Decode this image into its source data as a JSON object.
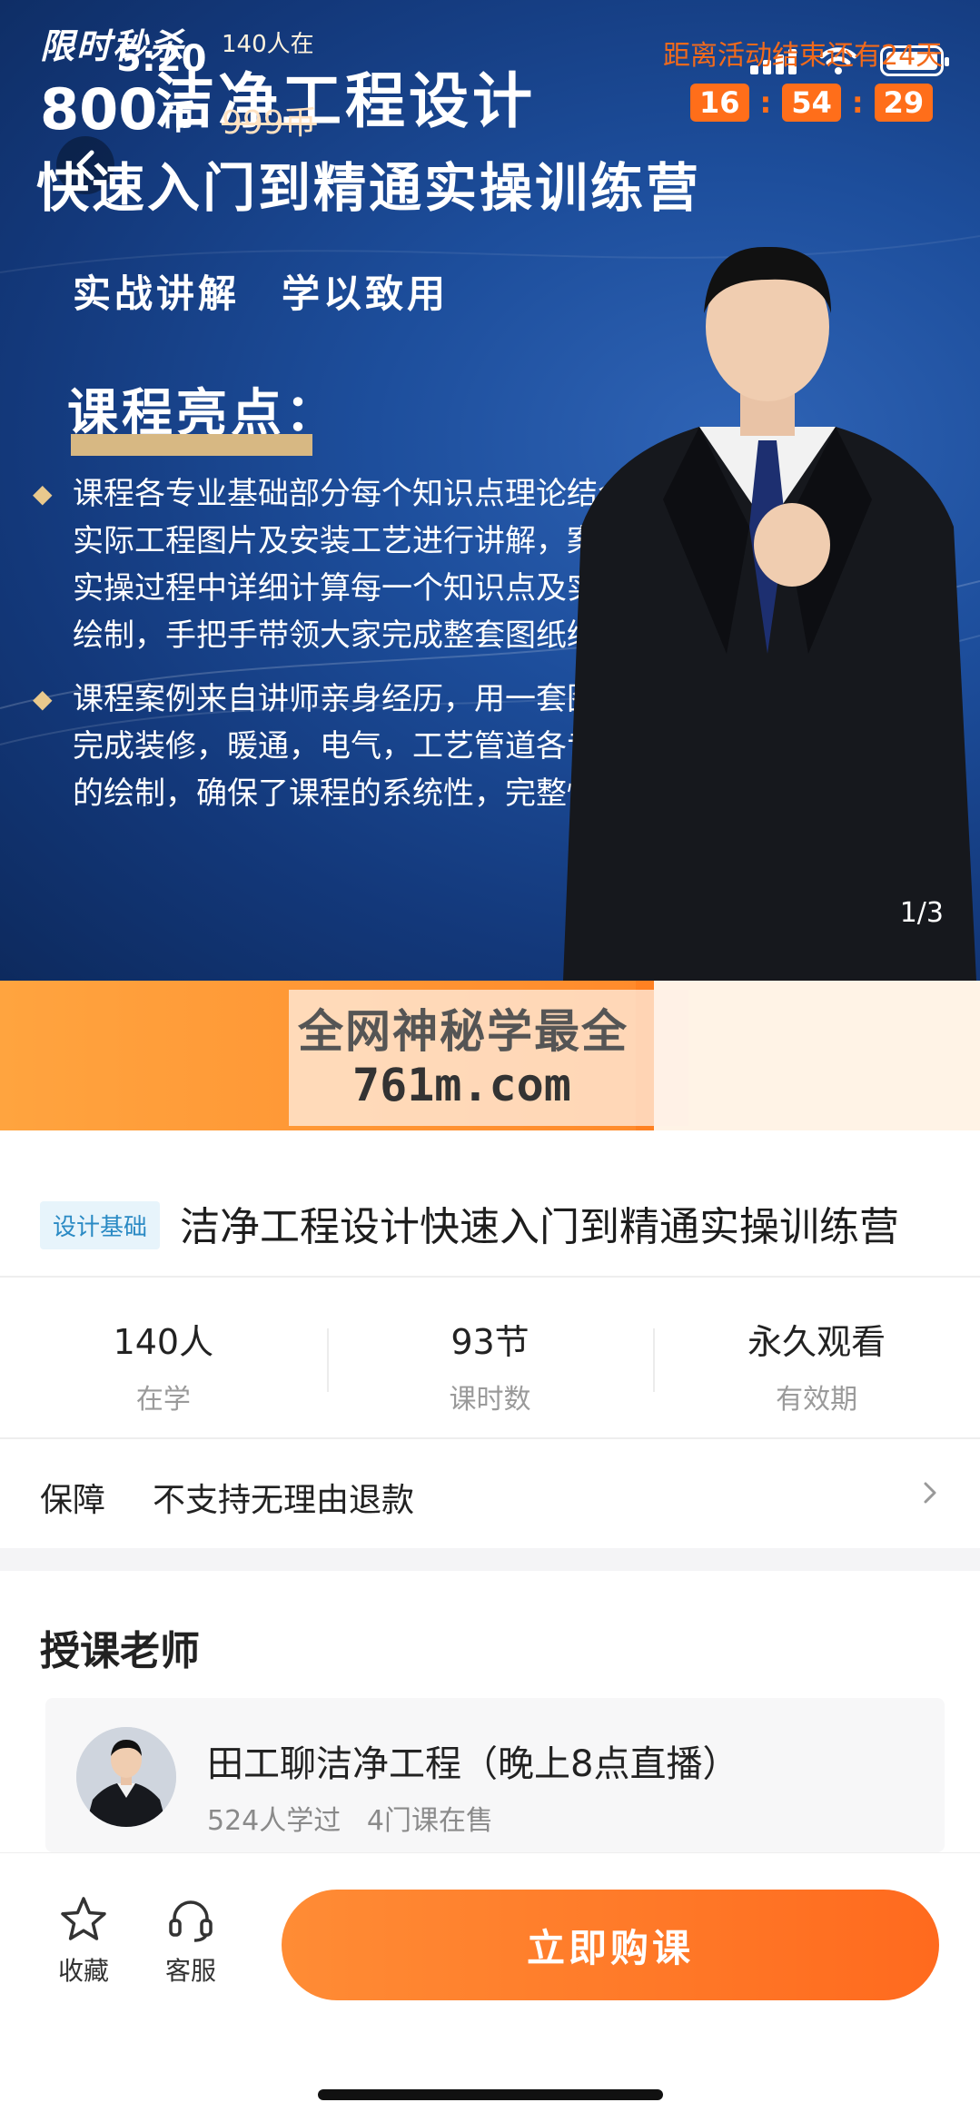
{
  "status_bar": {
    "time": "5:20"
  },
  "hero": {
    "title_line1": "洁净工程设计",
    "title_line2": "快速入门到精通实操训练营",
    "tagline": "实战讲解　学以致用",
    "highlight_heading": "课程亮点：",
    "points": [
      "课程各专业基础部分每个知识点理论结合实际工程图片及安装工艺进行讲解，案例实操过程中详细计算每一个知识点及实操绘制，手把手带领大家完成整套图纸绘制",
      "课程案例来自讲师亲身经历，用一套图纸完成装修，暖通，电气，工艺管道各专业的绘制，确保了课程的系统性，完整性"
    ],
    "page_indicator": "1/3"
  },
  "promo": {
    "title": "限时秒杀",
    "count": "140人在",
    "price": "800",
    "price_unit": "币",
    "original_price": "999币",
    "end_text": "距离活动结束还有24天",
    "timer": [
      "16",
      "54",
      "29"
    ],
    "watermark_line1": "全网神秘学最全",
    "watermark_line2": "761m.com"
  },
  "course": {
    "category": "设计基础",
    "title": "洁净工程设计快速入门到精通实操训练营"
  },
  "stats": [
    {
      "value": "140人",
      "label": "在学"
    },
    {
      "value": "93节",
      "label": "课时数"
    },
    {
      "value": "永久观看",
      "label": "有效期"
    }
  ],
  "guarantee": {
    "label": "保障",
    "value": "不支持无理由退款"
  },
  "teacher_section": {
    "title": "授课老师",
    "name": "田工聊洁净工程（晚上8点直播）",
    "learners": "524人学过",
    "courses": "4门课在售"
  },
  "bottom_bar": {
    "favorite_label": "收藏",
    "service_label": "客服",
    "buy_label": "立即购课"
  },
  "colors": {
    "accent": "#ff7a1d",
    "hero_bg": "#1d4e9c",
    "badge_text": "#2a8ac4"
  },
  "icons": [
    "back-icon",
    "signal-icon",
    "wifi-icon",
    "battery-icon",
    "star-icon",
    "headset-icon",
    "chevron-right-icon"
  ]
}
